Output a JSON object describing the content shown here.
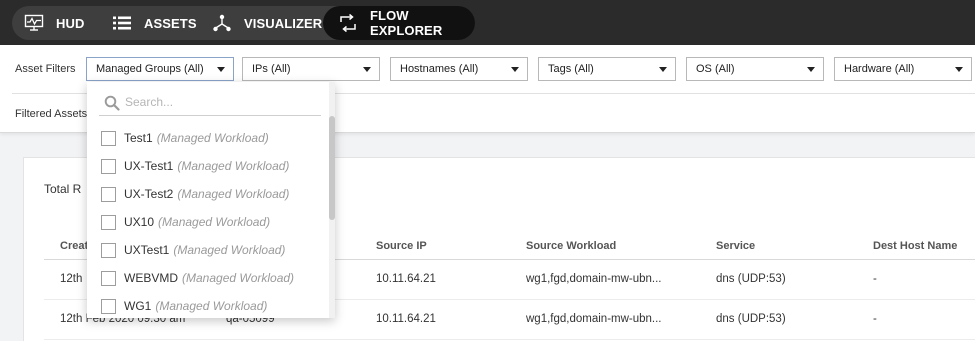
{
  "nav": {
    "tabs": [
      {
        "label": "HUD",
        "icon": "monitor-pulse-icon"
      },
      {
        "label": "ASSETS",
        "icon": "list-icon"
      },
      {
        "label": "VISUALIZER",
        "icon": "network-icon"
      },
      {
        "label": "FLOW EXPLORER",
        "icon": "flow-arrows-icon",
        "active": true
      }
    ]
  },
  "filters": {
    "label": "Asset Filters",
    "dropdowns": [
      {
        "label": "Managed Groups (All)",
        "open": true
      },
      {
        "label": "IPs (All)"
      },
      {
        "label": "Hostnames (All)"
      },
      {
        "label": "Tags (All)"
      },
      {
        "label": "OS (All)"
      },
      {
        "label": "Hardware (All)"
      }
    ],
    "filtered_label": "Filtered Assets"
  },
  "dropdown_panel": {
    "search_placeholder": "Search...",
    "options": [
      {
        "name": "Test1",
        "type": "(Managed Workload)"
      },
      {
        "name": "UX-Test1",
        "type": "(Managed Workload)"
      },
      {
        "name": "UX-Test2",
        "type": "(Managed Workload)"
      },
      {
        "name": "UX10",
        "type": "(Managed Workload)"
      },
      {
        "name": "UXTest1",
        "type": "(Managed Workload)"
      },
      {
        "name": "WEBVMD",
        "type": "(Managed Workload)"
      },
      {
        "name": "WG1",
        "type": "(Managed Workload)"
      }
    ]
  },
  "table": {
    "total_label": "Total R",
    "columns": [
      "Creat",
      "Source IP",
      "Source Workload",
      "Service",
      "Dest Host Name"
    ],
    "rows": [
      {
        "created": "12th",
        "host": "",
        "source_ip": "10.11.64.21",
        "source_workload": "wg1,fgd,domain-mw-ubn...",
        "service": "dns (UDP:53)",
        "dest_host": "-"
      },
      {
        "created": "12th Feb 2020 09:30 am",
        "host": "qa-05099",
        "source_ip": "10.11.64.21",
        "source_workload": "wg1,fgd,domain-mw-ubn...",
        "service": "dns (UDP:53)",
        "dest_host": "-"
      }
    ]
  },
  "colors": {
    "topbar": "#2b2b2b",
    "tabgroup": "#3e3e3e",
    "active_tab": "#111111"
  }
}
